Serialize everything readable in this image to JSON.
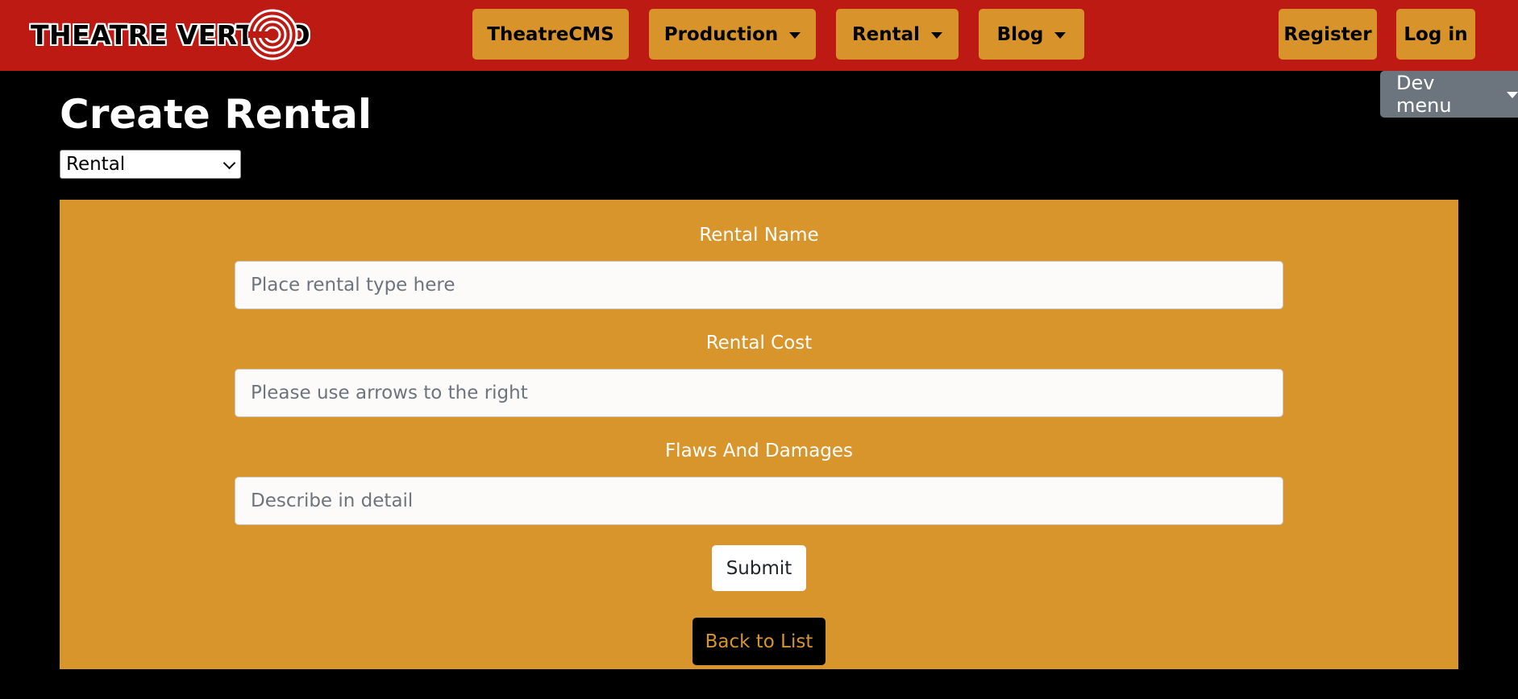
{
  "navbar": {
    "brand": "THEATRE VERTIGO",
    "items": [
      {
        "label": "TheatreCMS",
        "dropdown": false
      },
      {
        "label": "Production",
        "dropdown": true
      },
      {
        "label": "Rental",
        "dropdown": true
      },
      {
        "label": "Blog",
        "dropdown": true
      }
    ],
    "register_label": "Register",
    "login_label": "Log in",
    "colors": {
      "background": "#bd1a14",
      "button": "#d8932b"
    }
  },
  "dev_menu": {
    "label": "Dev menu"
  },
  "page": {
    "title": "Create Rental",
    "type_select": {
      "selected": "Rental"
    }
  },
  "form": {
    "background": "#d8952b",
    "fields": [
      {
        "label": "Rental Name",
        "placeholder": "Place rental type here"
      },
      {
        "label": "Rental Cost",
        "placeholder": "Please use arrows to the right"
      },
      {
        "label": "Flaws And Damages",
        "placeholder": "Describe in detail"
      }
    ],
    "submit_label": "Submit",
    "back_label": "Back to List"
  }
}
